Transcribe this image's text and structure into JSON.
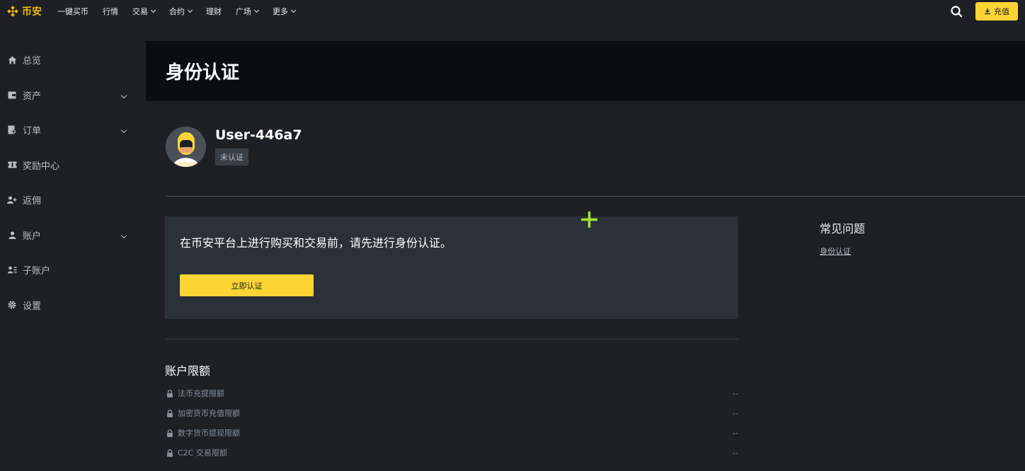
{
  "brand": {
    "name": "币安",
    "accent_color": "#f0b90b",
    "button_color": "#fcd535"
  },
  "nav": {
    "items": [
      {
        "label": "一键买币",
        "has_dropdown": false
      },
      {
        "label": "行情",
        "has_dropdown": false
      },
      {
        "label": "交易",
        "has_dropdown": true
      },
      {
        "label": "合约",
        "has_dropdown": true
      },
      {
        "label": "理财",
        "has_dropdown": false
      },
      {
        "label": "广场",
        "has_dropdown": true
      },
      {
        "label": "更多",
        "has_dropdown": true
      }
    ],
    "search_icon": "search-icon",
    "deposit_label": "充值"
  },
  "sidebar": {
    "items": [
      {
        "label": "总览",
        "icon": "home-icon",
        "expandable": false
      },
      {
        "label": "资产",
        "icon": "wallet-icon",
        "expandable": true
      },
      {
        "label": "订单",
        "icon": "orders-icon",
        "expandable": true
      },
      {
        "label": "奖励中心",
        "icon": "ticket-icon",
        "expandable": false
      },
      {
        "label": "返佣",
        "icon": "add-user-icon",
        "expandable": false
      },
      {
        "label": "账户",
        "icon": "user-icon",
        "expandable": true
      },
      {
        "label": "子账户",
        "icon": "sub-accounts-icon",
        "expandable": false
      },
      {
        "label": "设置",
        "icon": "gear-icon",
        "expandable": false
      }
    ]
  },
  "page": {
    "title": "身份认证"
  },
  "profile": {
    "username": "User-446a7",
    "status": "未认证"
  },
  "verify": {
    "message": "在币安平台上进行购买和交易前，请先进行身份认证。",
    "button_label": "立即认证"
  },
  "faq": {
    "title": "常见问题",
    "link": "身份认证"
  },
  "limits": {
    "title": "账户限额",
    "rows": [
      {
        "label": "法币充提限额",
        "value": "--"
      },
      {
        "label": "加密货币充值限额",
        "value": "--"
      },
      {
        "label": "数字货币提现限额",
        "value": "--"
      },
      {
        "label": "C2C 交易限额",
        "value": "--"
      }
    ]
  }
}
